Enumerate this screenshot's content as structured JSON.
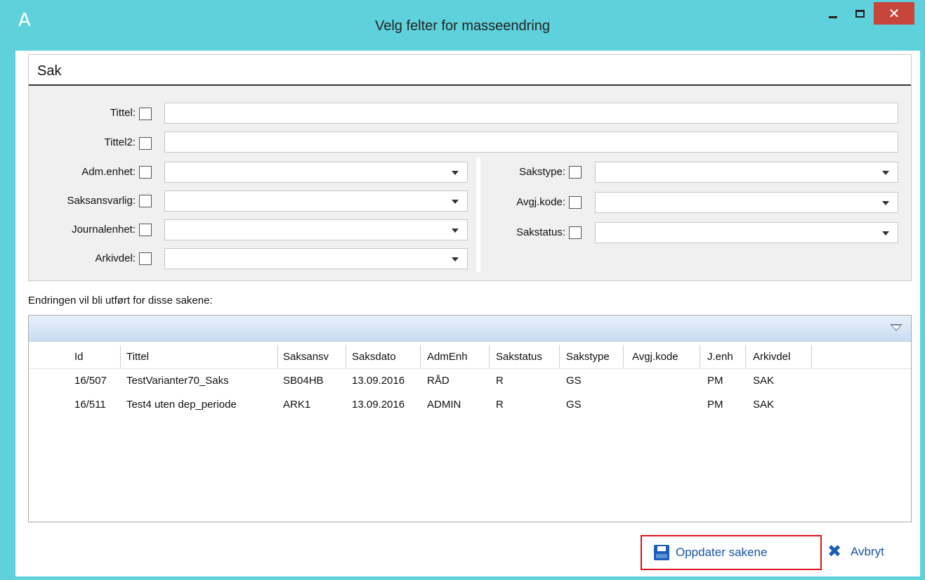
{
  "window": {
    "title": "Velg felter for masseendring",
    "logo": "A",
    "close_glyph": "✕"
  },
  "panel": {
    "title": "Sak",
    "fields_left": [
      {
        "label": "Tittel:"
      },
      {
        "label": "Tittel2:"
      },
      {
        "label": "Adm.enhet:"
      },
      {
        "label": "Saksansvarlig:"
      },
      {
        "label": "Journalenhet:"
      },
      {
        "label": "Arkivdel:"
      }
    ],
    "fields_right": [
      {
        "label": "Sakstype:"
      },
      {
        "label": "Avgj.kode:"
      },
      {
        "label": "Sakstatus:"
      }
    ]
  },
  "caption": "Endringen vil bli utført for disse sakene:",
  "grid": {
    "columns": [
      "Id",
      "Tittel",
      "Saksansv",
      "Saksdato",
      "AdmEnh",
      "Sakstatus",
      "Sakstype",
      "Avgj.kode",
      "J.enh",
      "Arkivdel"
    ],
    "rows": [
      [
        "16/507",
        "TestVarianter70_Saks",
        "SB04HB",
        "13.09.2016",
        "RÅD",
        "R",
        "GS",
        "",
        "PM",
        "SAK"
      ],
      [
        "16/511",
        "Test4 uten dep_periode",
        "ARK1",
        "13.09.2016",
        "ADMIN",
        "R",
        "GS",
        "",
        "PM",
        "SAK"
      ]
    ]
  },
  "buttons": {
    "update": "Oppdater sakene",
    "cancel": "Avbryt",
    "cancel_glyph": "✖"
  },
  "colors": {
    "titlebar": "#5fd1dc",
    "accent": "#1c5fb8",
    "highlight_border": "#e2141c",
    "close_button": "#c7453b"
  },
  "icons": {
    "app": "app-logo-icon",
    "save": "save-icon",
    "cancel": "close-x-icon",
    "filter": "filter-dropdown-icon"
  }
}
